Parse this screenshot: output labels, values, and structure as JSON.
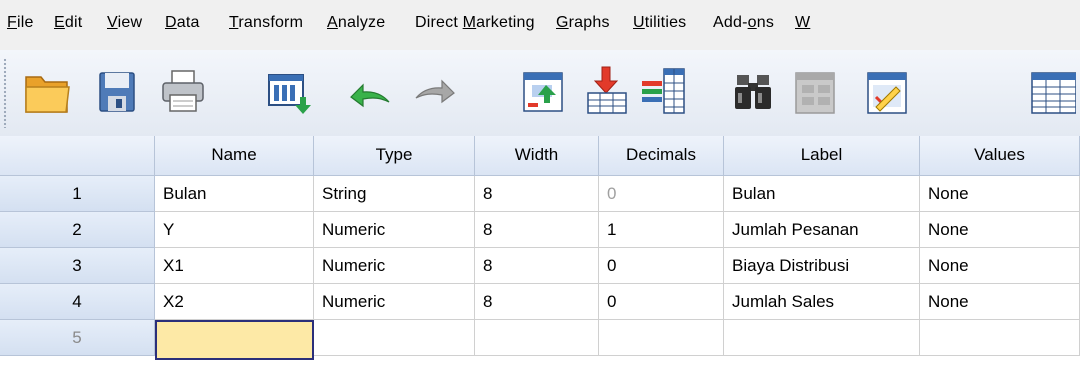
{
  "menu": {
    "items": [
      {
        "pre": "",
        "mn": "F",
        "post": "ile"
      },
      {
        "pre": "",
        "mn": "E",
        "post": "dit"
      },
      {
        "pre": "",
        "mn": "V",
        "post": "iew"
      },
      {
        "pre": "",
        "mn": "D",
        "post": "ata"
      },
      {
        "pre": "",
        "mn": "T",
        "post": "ransform"
      },
      {
        "pre": "",
        "mn": "A",
        "post": "nalyze"
      },
      {
        "pre": "Direct ",
        "mn": "M",
        "post": "arketing"
      },
      {
        "pre": "",
        "mn": "G",
        "post": "raphs"
      },
      {
        "pre": "",
        "mn": "U",
        "post": "tilities"
      },
      {
        "pre": "Add-",
        "mn": "o",
        "post": "ns"
      },
      {
        "pre": "",
        "mn": "W",
        "post": ""
      }
    ]
  },
  "toolbar": {
    "icons": [
      "open-folder-icon",
      "save-icon",
      "print-icon",
      "recall-dialog-icon",
      "undo-icon",
      "redo-icon",
      "goto-case-icon",
      "goto-variable-icon",
      "variables-icon",
      "find-icon",
      "insert-cases-icon",
      "insert-variable-icon",
      "split-file-icon"
    ]
  },
  "grid": {
    "columns": [
      "Name",
      "Type",
      "Width",
      "Decimals",
      "Label",
      "Values"
    ],
    "rows": [
      {
        "num": "1",
        "name": "Bulan",
        "type": "String",
        "width": "8",
        "decimals": "0",
        "label": "Bulan",
        "values": "None"
      },
      {
        "num": "2",
        "name": "Y",
        "type": "Numeric",
        "width": "8",
        "decimals": "1",
        "label": "Jumlah Pesanan",
        "values": "None"
      },
      {
        "num": "3",
        "name": "X1",
        "type": "Numeric",
        "width": "8",
        "decimals": "0",
        "label": "Biaya Distribusi",
        "values": "None"
      },
      {
        "num": "4",
        "name": "X2",
        "type": "Numeric",
        "width": "8",
        "decimals": "0",
        "label": "Jumlah Sales",
        "values": "None"
      }
    ],
    "empty_row_num": "5"
  },
  "colors": {
    "header_bg": "#dbe5f4",
    "active_cell": "#fde9a6",
    "active_border": "#2b2f7a"
  }
}
